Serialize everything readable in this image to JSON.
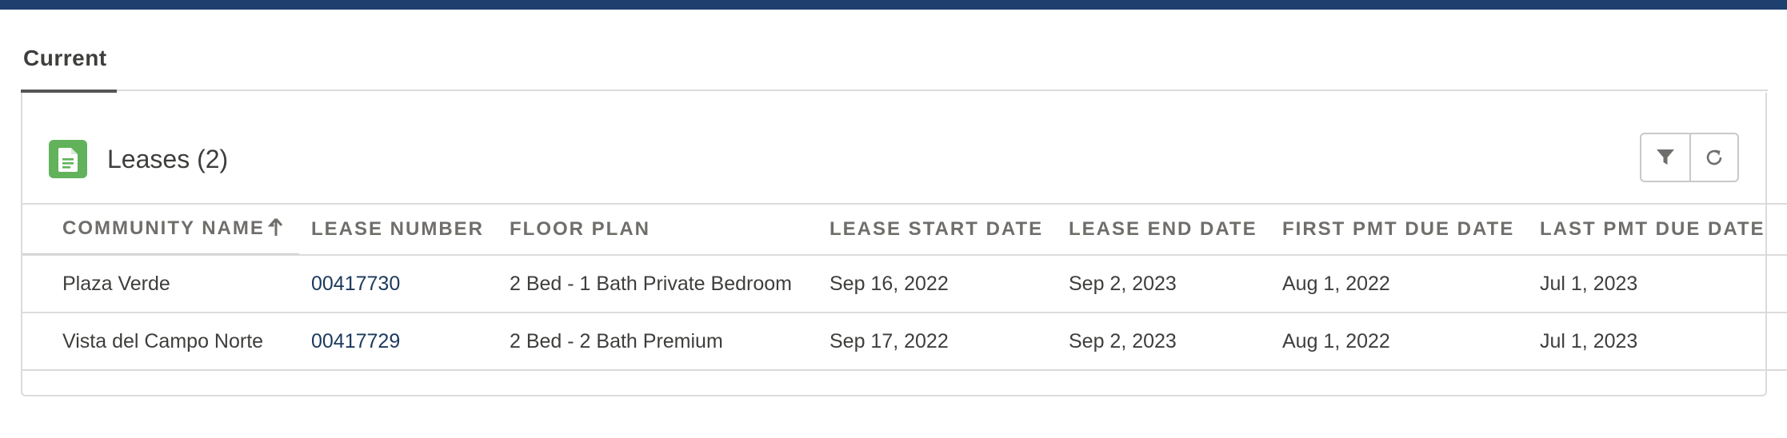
{
  "tabs": [
    {
      "label": "Current"
    }
  ],
  "card": {
    "title": "Leases (2)",
    "icon": "document-icon",
    "icon_color": "#62b25b",
    "buttons": [
      {
        "icon": "filter-icon"
      },
      {
        "icon": "refresh-icon"
      }
    ]
  },
  "table": {
    "columns": [
      {
        "label": "COMMUNITY NAME",
        "sorted": "ascending"
      },
      {
        "label": "LEASE NUMBER"
      },
      {
        "label": "FLOOR PLAN"
      },
      {
        "label": "LEASE START DATE"
      },
      {
        "label": "LEASE END DATE"
      },
      {
        "label": "FIRST PMT DUE DATE"
      },
      {
        "label": "LAST PMT DUE DATE"
      }
    ],
    "rows": [
      {
        "community": "Plaza Verde",
        "lease_number": "00417730",
        "floor_plan": "2 Bed - 1 Bath Private Bedroom",
        "start": "Sep 16, 2022",
        "end": "Sep 2, 2023",
        "first_pmt": "Aug 1, 2022",
        "last_pmt": "Jul 1, 2023"
      },
      {
        "community": "Vista del Campo Norte",
        "lease_number": "00417729",
        "floor_plan": "2 Bed - 2 Bath Premium",
        "start": "Sep 17, 2022",
        "end": "Sep 2, 2023",
        "first_pmt": "Aug 1, 2022",
        "last_pmt": "Jul 1, 2023"
      }
    ]
  },
  "colors": {
    "header_bar": "#1f3f6e",
    "link": "#1b3a5c"
  }
}
